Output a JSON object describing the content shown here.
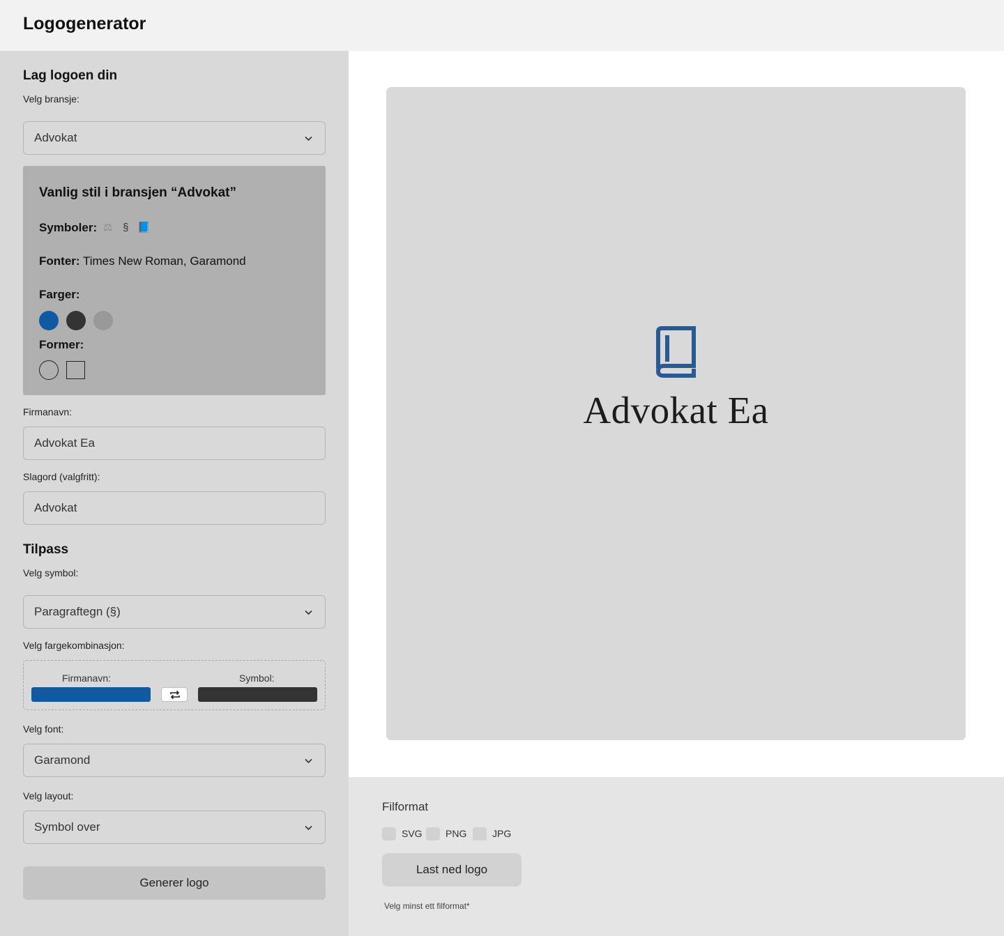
{
  "app": {
    "title": "Logogenerator"
  },
  "sidebar": {
    "heading": "Lag logoen din",
    "industry": {
      "label": "Velg bransje:",
      "value": "Advokat"
    },
    "style_card": {
      "title": "Vanlig stil i bransjen “Advokat”",
      "symbols_label": "Symboler:",
      "symbols": [
        "⚖",
        "§",
        "📘"
      ],
      "fonts_label": "Fonter:",
      "fonts_value": "Times New Roman, Garamond",
      "colors_label": "Farger:",
      "colors": [
        "#0f5aa0",
        "#333333",
        "#999999"
      ],
      "shapes_label": "Former:",
      "shapes": [
        "circle",
        "square"
      ]
    },
    "company": {
      "label": "Firmanavn:",
      "value": "Advokat Ea"
    },
    "slogan": {
      "label": "Slagord (valgfritt):",
      "value": "Advokat"
    },
    "customize_heading": "Tilpass",
    "symbol": {
      "label": "Velg symbol:",
      "value": "Paragraftegn (§)"
    },
    "color_combo": {
      "label": "Velg fargekombinasjon:",
      "company_label": "Firmanavn:",
      "symbol_label": "Symbol:",
      "company_color": "#0f5aa0",
      "symbol_color": "#333333"
    },
    "font": {
      "label": "Velg font:",
      "value": "Garamond"
    },
    "layout": {
      "label": "Velg layout:",
      "value": "Symbol over"
    },
    "generate_label": "Generer logo"
  },
  "preview": {
    "company_name": "Advokat Ea",
    "icon": "book-icon",
    "icon_color": "#2a5a94"
  },
  "download": {
    "title": "Filformat",
    "formats": [
      "SVG",
      "PNG",
      "JPG"
    ],
    "button_label": "Last ned logo",
    "hint": "Velg minst ett filformat*"
  }
}
